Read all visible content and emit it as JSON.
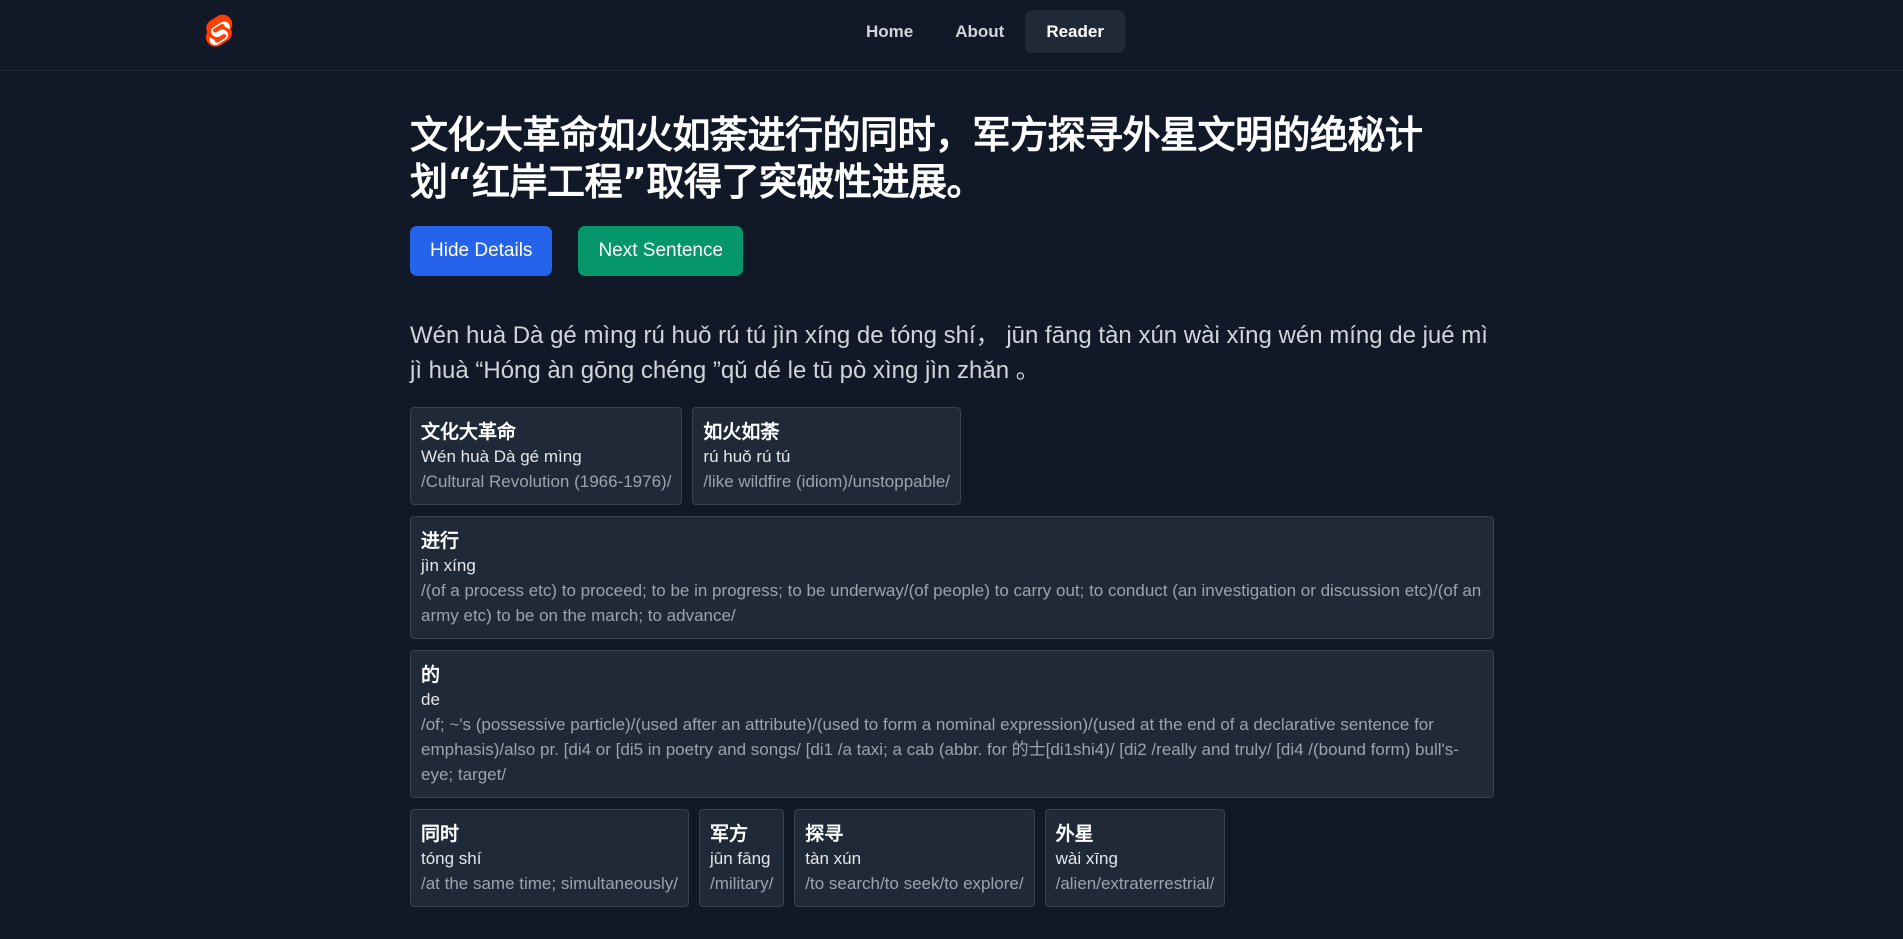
{
  "header": {
    "logo_icon": "svelte-logo-icon",
    "logo_color": "#ff3e00",
    "nav": [
      {
        "label": "Home",
        "active": false
      },
      {
        "label": "About",
        "active": false
      },
      {
        "label": "Reader",
        "active": true
      }
    ]
  },
  "reader": {
    "sentence": "文化大革命如火如荼进行的同时，军方探寻外星文明的绝秘计划“红岸工程”取得了突破性进展。",
    "hide_details_label": "Hide Details",
    "next_sentence_label": "Next Sentence",
    "pinyin": "Wén huà Dà gé mìng rú huǒ rú tú jìn xíng de tóng shí， jūn fāng tàn xún wài xīng wén míng de jué mì jì huà “Hóng àn gōng chéng ”qǔ dé le tū pò xìng jìn zhǎn 。",
    "words": [
      {
        "word": "文化大革命",
        "pinyin": "Wén huà Dà gé mìng",
        "definition": "/Cultural Revolution (1966-1976)/"
      },
      {
        "word": "如火如荼",
        "pinyin": "rú huǒ rú tú",
        "definition": "/like wildfire (idiom)/unstoppable/"
      },
      {
        "word": "进行",
        "pinyin": "jìn xíng",
        "definition": "/(of a process etc) to proceed; to be in progress; to be underway/(of people) to carry out; to conduct (an investigation or discussion etc)/(of an army etc) to be on the march; to advance/"
      },
      {
        "word": "的",
        "pinyin": "de",
        "definition": "/of; ~'s (possessive particle)/(used after an attribute)/(used to form a nominal expression)/(used at the end of a declarative sentence for emphasis)/also pr. [di4 or [di5 in poetry and songs/ [di1 /a taxi; a cab (abbr. for 的士[di1shi4)/ [di2 /really and truly/ [di4 /(bound form) bull's-eye; target/"
      },
      {
        "word": "同时",
        "pinyin": "tóng shí",
        "definition": "/at the same time; simultaneously/"
      },
      {
        "word": "军方",
        "pinyin": "jūn fāng",
        "definition": "/military/"
      },
      {
        "word": "探寻",
        "pinyin": "tàn xún",
        "definition": "/to search/to seek/to explore/"
      },
      {
        "word": "外星",
        "pinyin": "wài xīng",
        "definition": "/alien/extraterrestrial/"
      }
    ]
  }
}
